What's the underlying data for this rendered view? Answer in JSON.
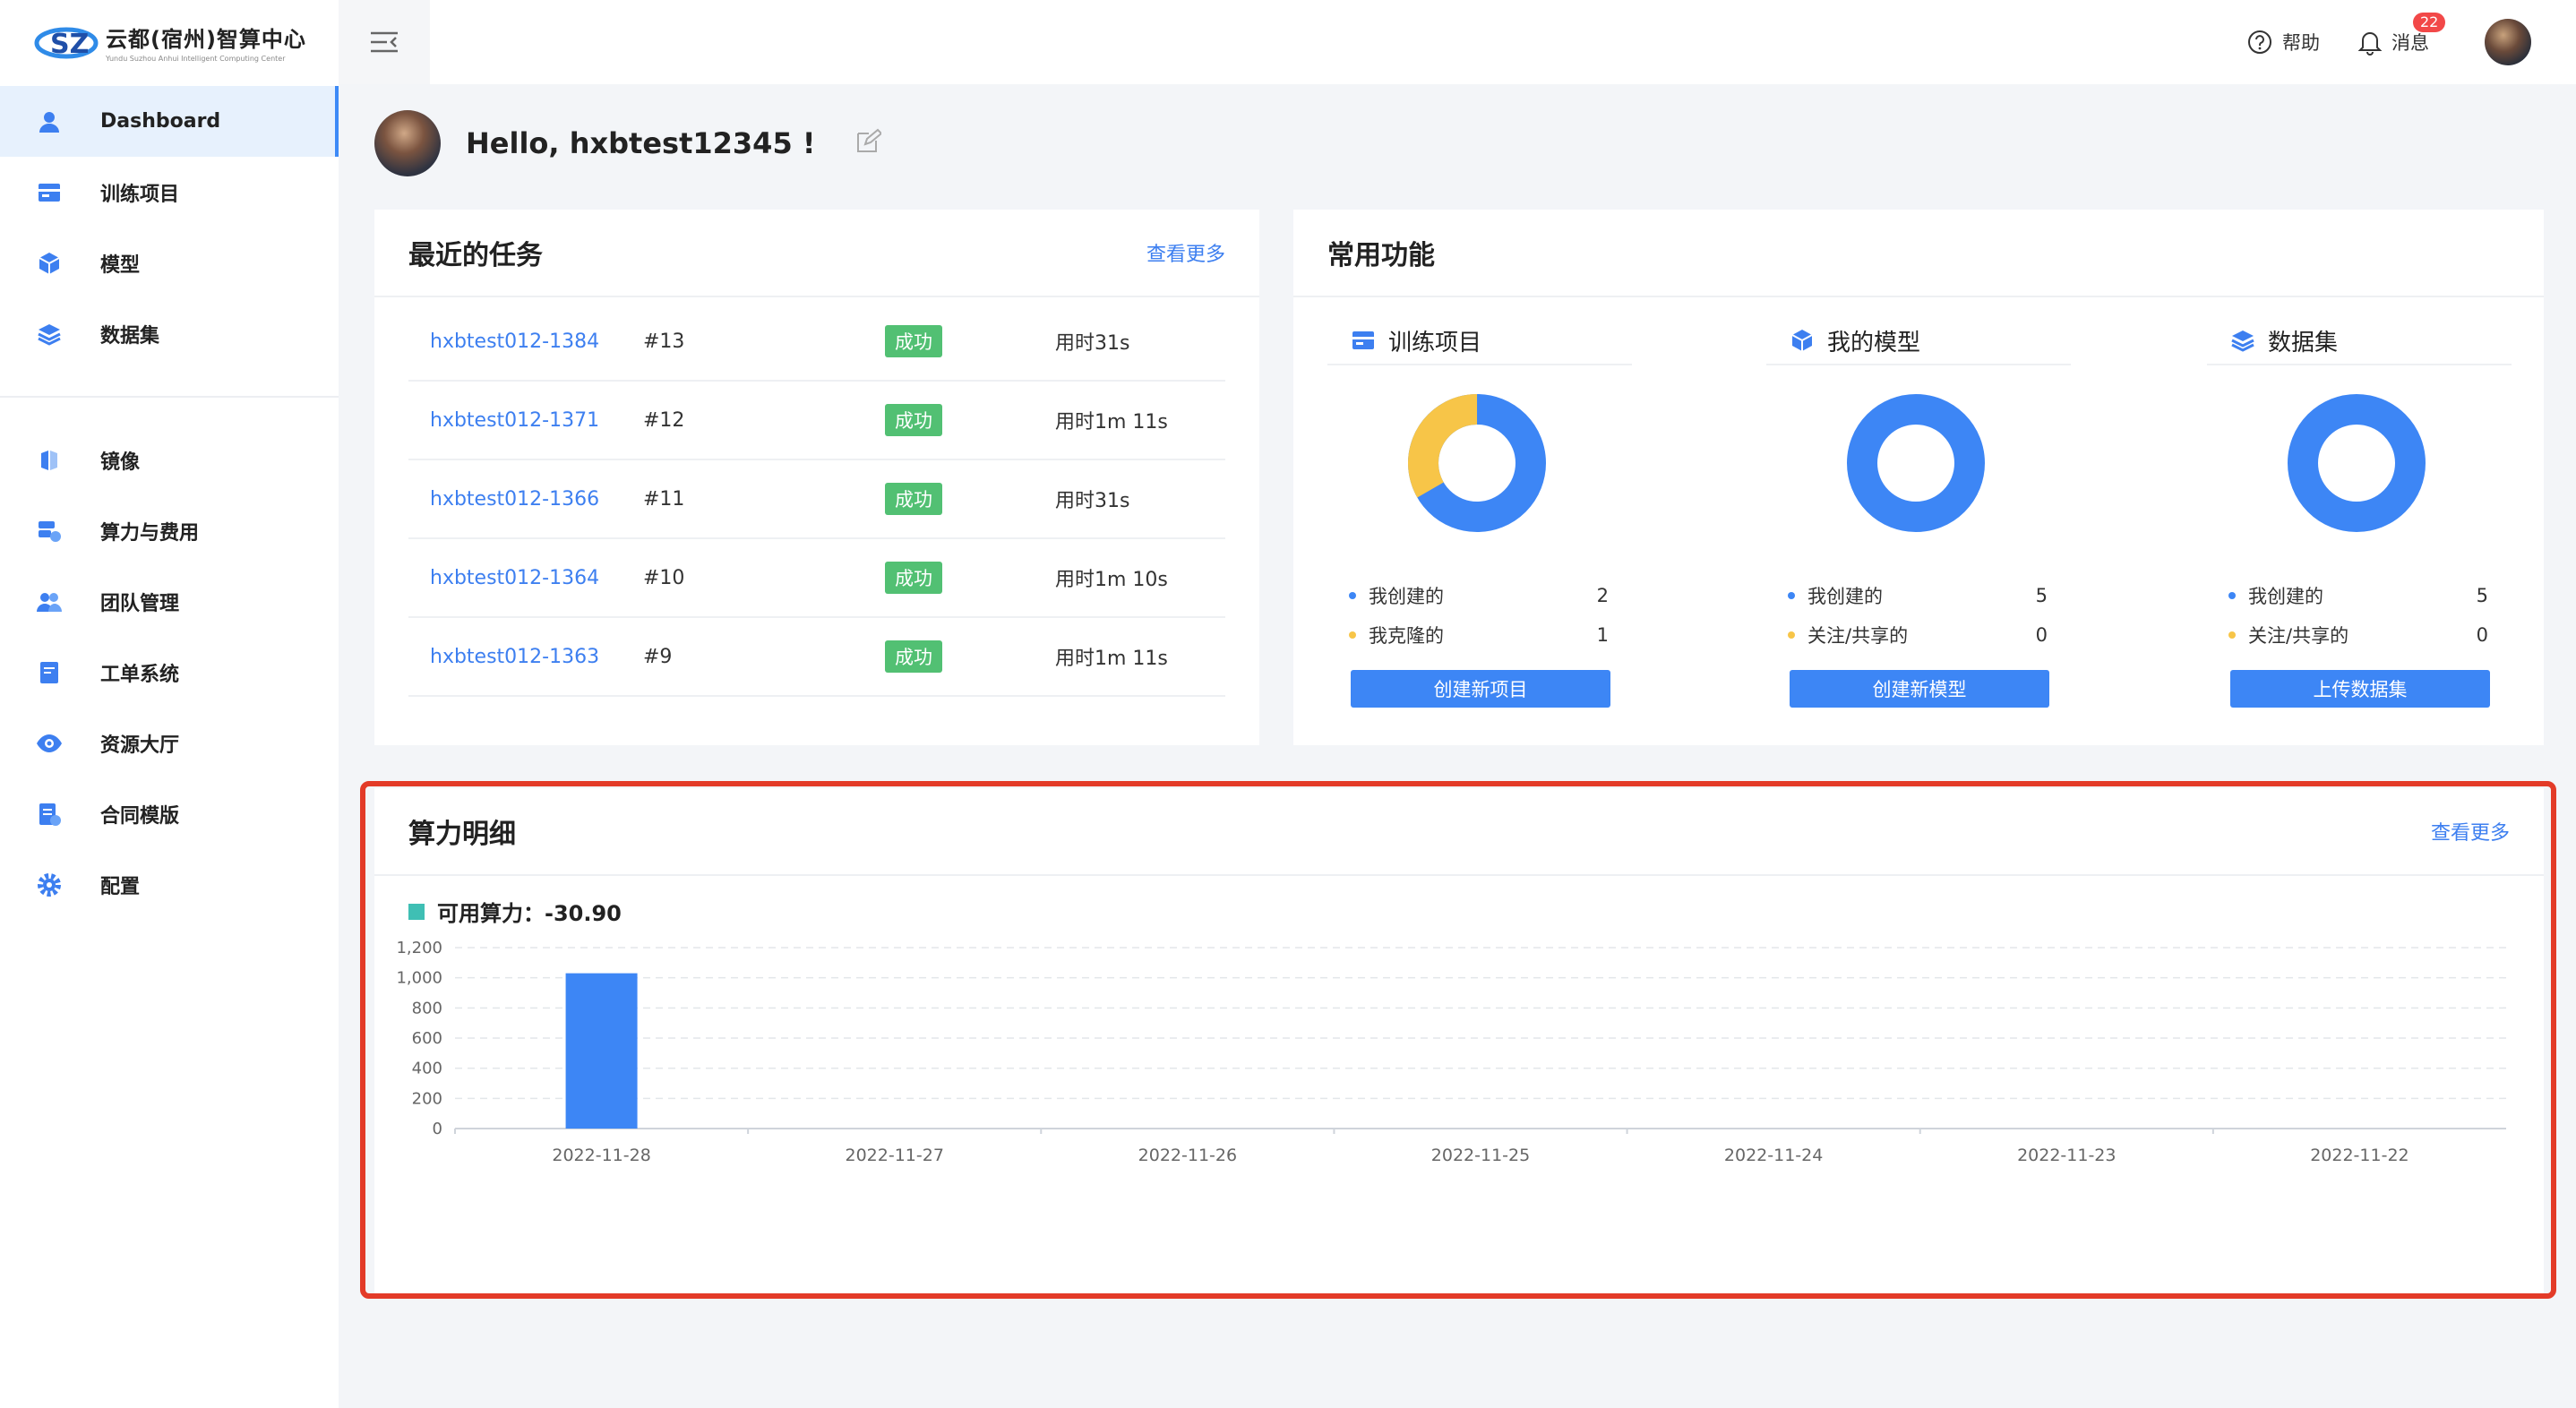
{
  "app": {
    "logo_title": "云都(宿州)智算中心",
    "logo_subtitle": "Yundu Suzhou Anhui Intelligent Computing Center"
  },
  "sidebar": {
    "items": [
      {
        "label": "Dashboard",
        "icon": "user-icon",
        "active": true
      },
      {
        "label": "训练项目",
        "icon": "project-icon"
      },
      {
        "label": "模型",
        "icon": "cube-icon"
      },
      {
        "label": "数据集",
        "icon": "layers-icon"
      },
      {
        "label": "镜像",
        "icon": "image-icon"
      },
      {
        "label": "算力与费用",
        "icon": "billing-icon"
      },
      {
        "label": "团队管理",
        "icon": "team-icon"
      },
      {
        "label": "工单系统",
        "icon": "ticket-icon"
      },
      {
        "label": "资源大厅",
        "icon": "eye-icon"
      },
      {
        "label": "合同模版",
        "icon": "contract-icon"
      },
      {
        "label": "配置",
        "icon": "gear-icon"
      }
    ]
  },
  "topbar": {
    "help_label": "帮助",
    "messages_label": "消息",
    "messages_badge": "22"
  },
  "greeting": "Hello, hxbtest12345 !",
  "recent_tasks": {
    "title": "最近的任务",
    "more_label": "查看更多",
    "rows": [
      {
        "name": "hxbtest012-1384",
        "num": "#13",
        "status": "成功",
        "time": "用时31s"
      },
      {
        "name": "hxbtest012-1371",
        "num": "#12",
        "status": "成功",
        "time": "用时1m 11s"
      },
      {
        "name": "hxbtest012-1366",
        "num": "#11",
        "status": "成功",
        "time": "用时31s"
      },
      {
        "name": "hxbtest012-1364",
        "num": "#10",
        "status": "成功",
        "time": "用时1m 10s"
      },
      {
        "name": "hxbtest012-1363",
        "num": "#9",
        "status": "成功",
        "time": "用时1m 11s"
      }
    ]
  },
  "common_functions": {
    "title": "常用功能",
    "columns": [
      {
        "title": "训练项目",
        "icon": "project-icon",
        "legend": [
          {
            "label": "我创建的",
            "value": "2",
            "color": "#3d86f5"
          },
          {
            "label": "我克隆的",
            "value": "1",
            "color": "#f7c548"
          }
        ],
        "button": "创建新项目"
      },
      {
        "title": "我的模型",
        "icon": "cube-icon",
        "legend": [
          {
            "label": "我创建的",
            "value": "5",
            "color": "#3d86f5"
          },
          {
            "label": "关注/共享的",
            "value": "0",
            "color": "#f7c548"
          }
        ],
        "button": "创建新模型"
      },
      {
        "title": "数据集",
        "icon": "layers-icon",
        "legend": [
          {
            "label": "我创建的",
            "value": "5",
            "color": "#3d86f5"
          },
          {
            "label": "关注/共享的",
            "value": "0",
            "color": "#f7c548"
          }
        ],
        "button": "上传数据集"
      }
    ]
  },
  "compute": {
    "title": "算力明细",
    "more_label": "查看更多",
    "available_label": "可用算力：-30.90"
  },
  "chart_data": {
    "type": "bar",
    "categories": [
      "2022-11-28",
      "2022-11-27",
      "2022-11-26",
      "2022-11-25",
      "2022-11-24",
      "2022-11-23",
      "2022-11-22"
    ],
    "values": [
      1030,
      0,
      0,
      0,
      0,
      0,
      0
    ],
    "ylim": [
      0,
      1200
    ],
    "yticks": [
      "0",
      "200",
      "400",
      "600",
      "800",
      "1,000",
      "1,200"
    ],
    "grid": true,
    "bar_color": "#3d86f5"
  }
}
